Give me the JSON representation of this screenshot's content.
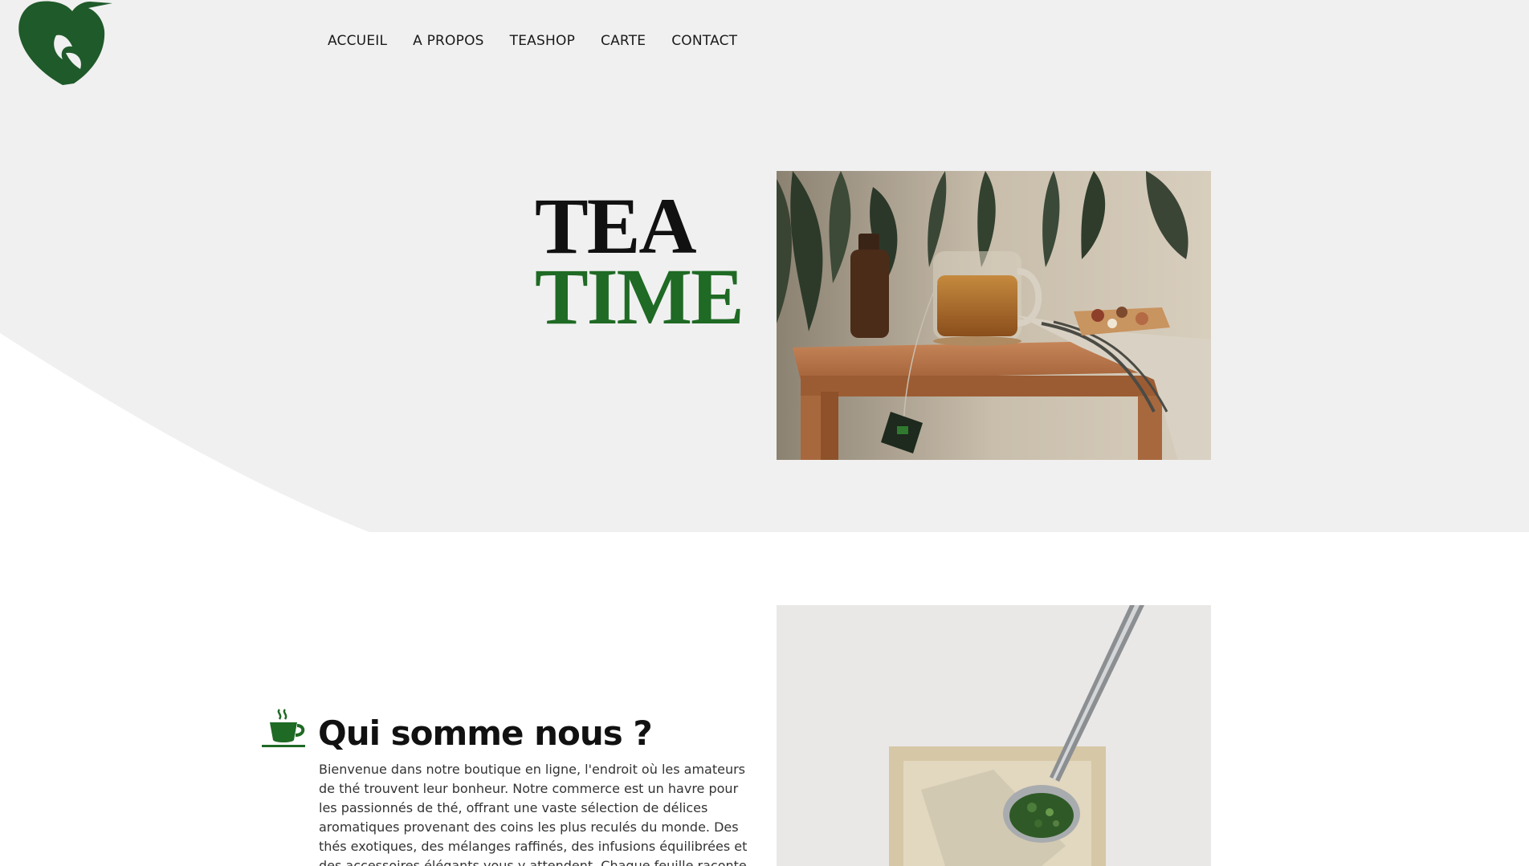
{
  "nav": {
    "items": [
      "ACCUEIL",
      "A PROPOS",
      "TEASHOP",
      "CARTE",
      "CONTACT"
    ]
  },
  "hero": {
    "title_line1": "TEA",
    "title_line2": "TIME"
  },
  "about": {
    "title": "Qui somme nous ?",
    "text": "Bienvenue dans notre boutique en ligne, l'endroit où les amateurs de thé trouvent leur bonheur. Notre commerce est un havre pour les passionnés de thé, offrant une vaste sélection de délices aromatiques provenant des coins les plus reculés du monde. Des thés exotiques, des mélanges raffinés, des infusions équilibrées et des accessoires élégants vous y attendent. Chaque feuille raconte"
  },
  "colors": {
    "brand_green": "#1f6a24",
    "hero_bg": "#f0f0f0",
    "text_dark": "#111111"
  },
  "icons": {
    "logo": "heart-leaf-logo",
    "about": "teacup-icon"
  }
}
